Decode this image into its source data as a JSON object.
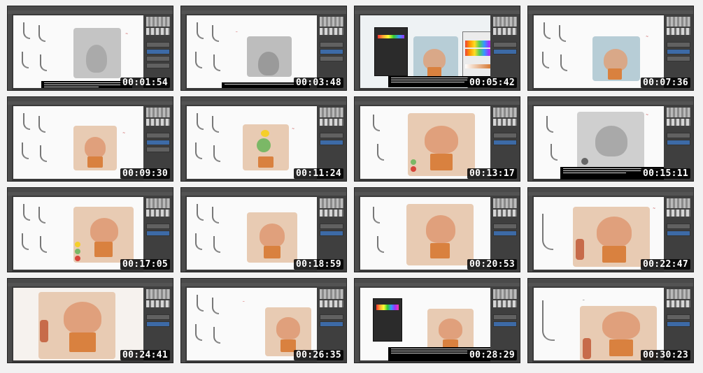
{
  "thumbnails": [
    {
      "timestamp": "00:01:54",
      "scene": "gray-nose"
    },
    {
      "timestamp": "00:03:48",
      "scene": "gray-nose-menu"
    },
    {
      "timestamp": "00:05:42",
      "scene": "blue-nose-color-picker"
    },
    {
      "timestamp": "00:07:36",
      "scene": "blue-nose"
    },
    {
      "timestamp": "00:09:30",
      "scene": "warm-nose"
    },
    {
      "timestamp": "00:11:24",
      "scene": "warm-nose-swatches"
    },
    {
      "timestamp": "00:13:17",
      "scene": "warm-nose-zoom"
    },
    {
      "timestamp": "00:15:11",
      "scene": "gray-zoom-subtitle"
    },
    {
      "timestamp": "00:17:05",
      "scene": "warm-nose-dots"
    },
    {
      "timestamp": "00:18:59",
      "scene": "warm-nose-2"
    },
    {
      "timestamp": "00:20:53",
      "scene": "warm-nose-3"
    },
    {
      "timestamp": "00:22:47",
      "scene": "warm-nose-closeup"
    },
    {
      "timestamp": "00:24:41",
      "scene": "warm-nose-fullzoom"
    },
    {
      "timestamp": "00:26:35",
      "scene": "warm-nose-sketches"
    },
    {
      "timestamp": "00:28:29",
      "scene": "warm-nose-dialog-subtitle"
    },
    {
      "timestamp": "00:30:23",
      "scene": "warm-nose-final"
    }
  ],
  "colors": {
    "page_bg": "#f2f2f2",
    "app_chrome": "#3a3a3a",
    "canvas": "#fafafa",
    "timestamp_bg": "#000000",
    "timestamp_fg": "#ffffff",
    "gray_paint": "#c9c9c9",
    "blue_paint": "#b7cdd6",
    "warm_paint": "#e8cbb3",
    "orange_accent": "#d9813f"
  }
}
